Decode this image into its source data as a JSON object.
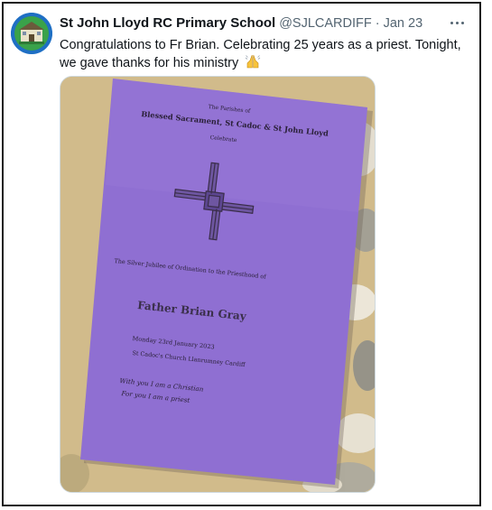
{
  "tweet": {
    "author_name": "St John Lloyd RC Primary School",
    "author_handle": "@SJLCARDIFF",
    "separator": "·",
    "timestamp": "Jan 23",
    "text": "Congratulations to Fr Brian. Celebrating 25 years as a priest. Tonight, we gave thanks for his ministry",
    "emoji_icon": "folded-hands-icon",
    "more_icon": "more-options-icon"
  },
  "photo": {
    "leaflet": {
      "line1": "The Parishes of",
      "line2": "Blessed Sacrament, St Cadoc & St John Lloyd",
      "line3": "Celebrate",
      "line4": "The Silver Jubilee of Ordination to the Priesthood of",
      "line5": "Father Brian Gray",
      "line6": "Monday 23rd January 2023",
      "line7": "St Cadoc's Church Llanrumney Cardiff",
      "line8": "With you I am a Christian",
      "line9": "For you I am a priest"
    }
  },
  "colors": {
    "text_primary": "#0f1419",
    "text_secondary": "#536471",
    "leaflet_purple": "#8f6fd2",
    "frame": "#1a1a1a"
  }
}
